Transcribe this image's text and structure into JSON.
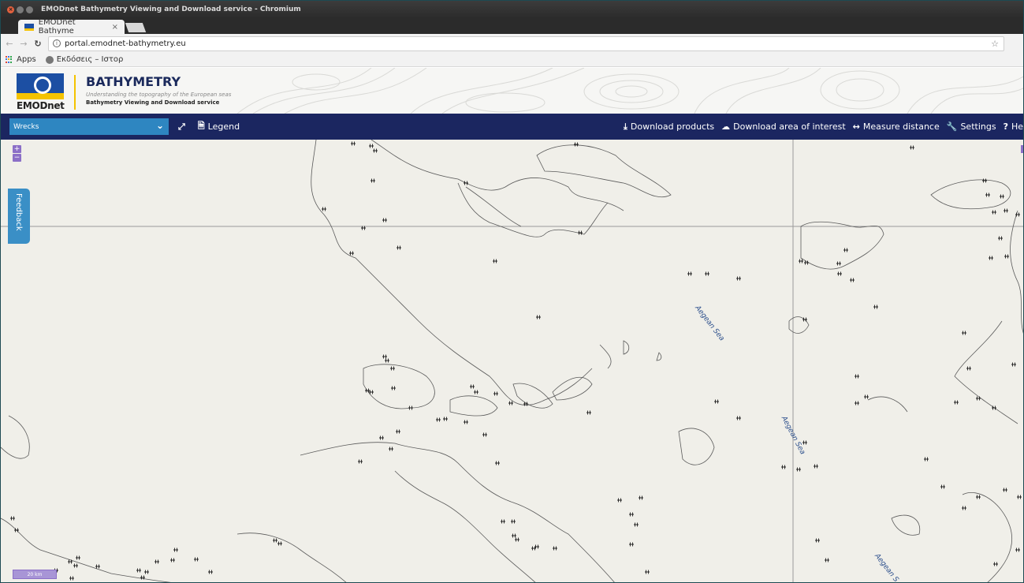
{
  "window": {
    "title": "EMODnet Bathymetry Viewing and Download service - Chromium"
  },
  "browser": {
    "tab_title": "EMODnet Bathyme",
    "tab_close": "×",
    "url": "portal.emodnet-bathymetry.eu",
    "bookmarks": [
      {
        "label": "Apps"
      },
      {
        "label": "Εκδόσεις – Ιστορ"
      }
    ]
  },
  "site": {
    "logo_text": "EMODnet",
    "title": "BATHYMETRY",
    "tagline": "Understanding the topography of the European seas",
    "subtitle": "Bathymetry Viewing and Download service"
  },
  "toolbar": {
    "layer_selected": "Wrecks",
    "legend_label": "Legend",
    "download_products": "Download products",
    "download_area": "Download area of interest",
    "measure_distance": "Measure distance",
    "settings": "Settings",
    "help": "He"
  },
  "map": {
    "zoom_in": "+",
    "zoom_out": "−",
    "feedback_label": "Feedback",
    "scale_label": "20 km",
    "sea_labels": [
      "Aegean Sea",
      "Aegean Sea",
      "Aegean S"
    ],
    "marker_symbol": "+"
  },
  "icons": {
    "layer_dropdown": "chevron-down-icon",
    "fullscreen": "fullscreen-icon",
    "legend": "document-icon",
    "download": "download-icon",
    "cloud_download": "cloud-download-icon",
    "measure": "arrows-horizontal-icon",
    "settings": "wrench-icon",
    "help": "question-icon"
  },
  "colors": {
    "toolbar_bg": "#1b2660",
    "select_bg": "#2e86c1",
    "map_bg": "#f0efe9",
    "accent": "#f4c300",
    "control_purple": "#8b6fc7",
    "sea_label": "#2c4f8c"
  }
}
